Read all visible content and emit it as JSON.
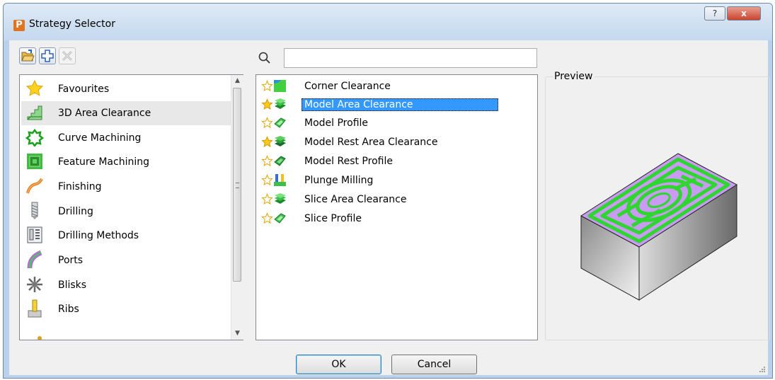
{
  "window": {
    "app_icon_letter": "P",
    "title": "Strategy Selector",
    "help_glyph": "?",
    "close_glyph": "x"
  },
  "toolbar": {
    "buttons": [
      {
        "name": "open-folder-button",
        "icon": "open-folder-icon",
        "enabled": true
      },
      {
        "name": "add-button",
        "icon": "plus-icon",
        "enabled": true
      },
      {
        "name": "remove-button",
        "icon": "remove-icon",
        "enabled": false
      }
    ]
  },
  "categories": [
    {
      "label": "Favourites",
      "icon": "star-icon",
      "selected": false
    },
    {
      "label": "3D Area Clearance",
      "icon": "area-clearance-icon",
      "selected": true
    },
    {
      "label": "Curve Machining",
      "icon": "curve-machining-icon",
      "selected": false
    },
    {
      "label": "Feature Machining",
      "icon": "feature-machining-icon",
      "selected": false
    },
    {
      "label": "Finishing",
      "icon": "finishing-icon",
      "selected": false
    },
    {
      "label": "Drilling",
      "icon": "drilling-icon",
      "selected": false
    },
    {
      "label": "Drilling Methods",
      "icon": "drilling-methods-icon",
      "selected": false
    },
    {
      "label": "Ports",
      "icon": "ports-icon",
      "selected": false
    },
    {
      "label": "Blisks",
      "icon": "blisks-icon",
      "selected": false
    },
    {
      "label": "Ribs",
      "icon": "ribs-icon",
      "selected": false
    }
  ],
  "search": {
    "icon": "search-icon",
    "value": "",
    "placeholder": ""
  },
  "strategies": [
    {
      "label": "Corner Clearance",
      "favourite": false,
      "icon": "corner-clearance-icon",
      "selected": false
    },
    {
      "label": "Model Area Clearance",
      "favourite": true,
      "icon": "model-area-clearance-icon",
      "selected": true
    },
    {
      "label": "Model Profile",
      "favourite": false,
      "icon": "model-profile-icon",
      "selected": false
    },
    {
      "label": "Model Rest Area Clearance",
      "favourite": true,
      "icon": "model-rest-area-clearance-icon",
      "selected": false
    },
    {
      "label": "Model Rest Profile",
      "favourite": false,
      "icon": "model-rest-profile-icon",
      "selected": false
    },
    {
      "label": "Plunge Milling",
      "favourite": false,
      "icon": "plunge-milling-icon",
      "selected": false
    },
    {
      "label": "Slice Area Clearance",
      "favourite": false,
      "icon": "slice-area-clearance-icon",
      "selected": false
    },
    {
      "label": "Slice Profile",
      "favourite": false,
      "icon": "slice-profile-icon",
      "selected": false
    }
  ],
  "preview": {
    "label": "Preview",
    "image": "model-area-clearance-preview"
  },
  "buttons": {
    "ok": "OK",
    "cancel": "Cancel"
  },
  "colors": {
    "selection": "#3399ff",
    "toolpath_green": "#3ddc3d",
    "stock_top_purple": "#c99bf2"
  }
}
